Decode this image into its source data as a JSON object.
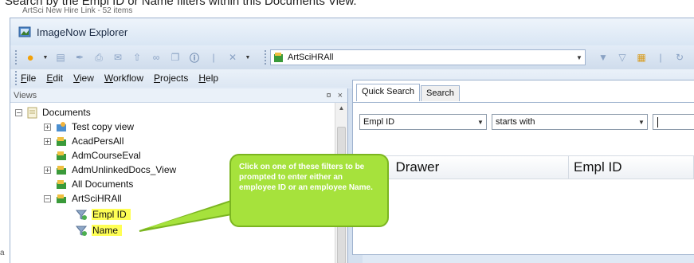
{
  "caption": {
    "text": "Search by the Empl ID or Name filters within this Documents View.",
    "sub": "ArtSci New Hire Link - 52 items"
  },
  "window": {
    "title": "ImageNow Explorer"
  },
  "toolbar": {
    "view_selector": {
      "value": "ArtSciHRAll"
    }
  },
  "menu": {
    "items": [
      "File",
      "Edit",
      "View",
      "Workflow",
      "Projects",
      "Help"
    ]
  },
  "views_panel": {
    "title": "Views",
    "pin": "¤",
    "close": "×",
    "tree": {
      "root": "Documents",
      "items": [
        "Test copy view",
        "AcadPersAll",
        "AdmCourseEval",
        "AdmUnlinkedDocs_View",
        "All Documents",
        "ArtSciHRAll"
      ],
      "filters": [
        "Empl ID",
        "Name"
      ]
    }
  },
  "search_panel": {
    "tabs": [
      "Quick Search",
      "Search"
    ],
    "field_select": "Empl ID",
    "operator_select": "starts with",
    "value": "",
    "columns": [
      "Drawer",
      "Empl ID"
    ]
  },
  "callout": {
    "text": "Click on one of these filters to be prompted to enter either an employee ID or an employee Name."
  },
  "edge_mark": "a",
  "colors": {
    "callout_fill": "#a6e23c",
    "highlight": "#ffff55",
    "window_bg": "#dfe9f5"
  }
}
